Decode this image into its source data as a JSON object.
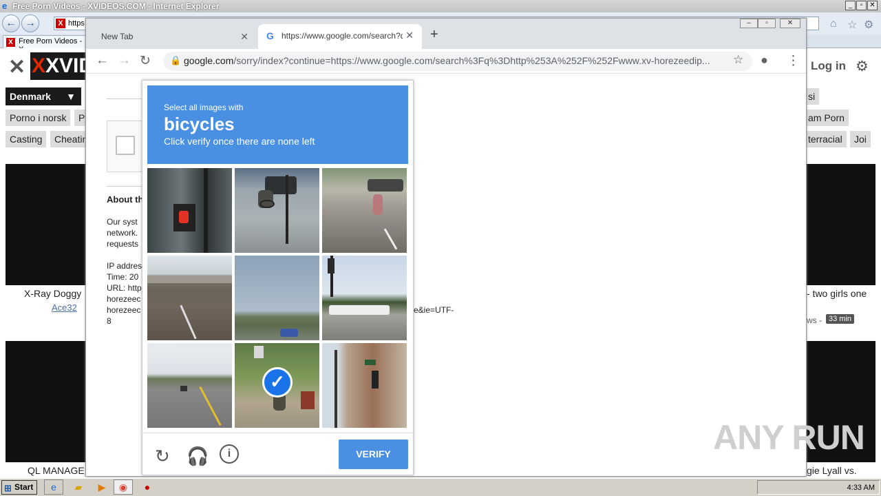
{
  "ie": {
    "title": "Free Porn Videos - XVIDEOS.COM - Internet Explorer",
    "address": "https",
    "tab_label": "Free Porn Videos - X",
    "controls": [
      "_",
      "▫",
      "✕"
    ]
  },
  "xvideos": {
    "logo": "XVID",
    "login": "Log in",
    "country": "Denmark",
    "tags_row1": [
      "Porno i norsk",
      "P"
    ],
    "tags_row2": [
      "Casting",
      "Cheatin"
    ],
    "tags_right1": [
      "si"
    ],
    "tags_right2": [
      "am Porn"
    ],
    "tags_right3": [
      "terracial",
      "Joi"
    ],
    "video1_title": "X-Ray Doggy",
    "video1_uploader": "Ace32",
    "video2_title": "- two girls one",
    "video2_views": "ws -",
    "video2_duration": "33 min",
    "video3_title": "QL MANAGE",
    "video4_title": "gie Lyall vs."
  },
  "chrome": {
    "tab1_label": "New Tab",
    "tab2_label": "https://www.google.com/search?q=",
    "omni_host": "google.com",
    "omni_rest": "/sorry/index?continue=https://www.google.com/search%3Fq%3Dhttp%253A%252F%252Fwww.xv-horezeedip..."
  },
  "sorry_page": {
    "about": "About th",
    "para": [
      "Our syst",
      "network.",
      "requests"
    ],
    "info": [
      "IP addres",
      "Time: 20",
      "URL: http",
      "horezeec",
      "horezeec",
      "8"
    ],
    "tail": "e&ie=UTF-"
  },
  "captcha": {
    "prompt_small": "Select all images with",
    "prompt_big": "bicycles",
    "prompt_sub": "Click verify once there are none left",
    "verify_label": "VERIFY",
    "tiles": [
      {
        "name": "tile-crosswalk-signal",
        "selected": false
      },
      {
        "name": "tile-cyclist-street",
        "selected": false
      },
      {
        "name": "tile-cyclist-lane",
        "selected": false
      },
      {
        "name": "tile-overpass",
        "selected": false
      },
      {
        "name": "tile-field",
        "selected": false
      },
      {
        "name": "tile-intersection",
        "selected": false
      },
      {
        "name": "tile-road",
        "selected": false
      },
      {
        "name": "tile-cyclist-sidewalk",
        "selected": true
      },
      {
        "name": "tile-building-corner",
        "selected": false
      }
    ]
  },
  "taskbar": {
    "start_label": "Start",
    "clock": "4:33 AM"
  },
  "watermark": "ANY RUN"
}
